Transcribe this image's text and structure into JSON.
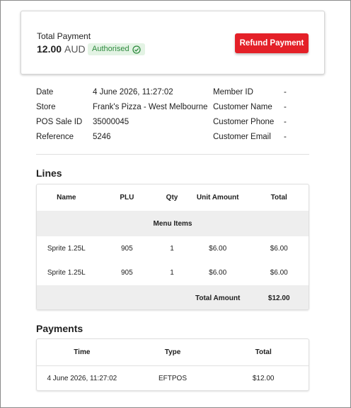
{
  "summary": {
    "total_label": "Total Payment",
    "amount": "12.00",
    "currency": "AUD",
    "status": "Authorised",
    "refund_button": "Refund Payment",
    "status_icon": "check-circle-icon",
    "accent_color": "#e42028",
    "status_color": "#2e8b3e"
  },
  "details_left": [
    {
      "label": "Date",
      "value": "4 June 2026, 11:27:02"
    },
    {
      "label": "Store",
      "value": "Frank's Pizza - West Melbourne"
    },
    {
      "label": "POS Sale ID",
      "value": "35000045"
    },
    {
      "label": "Reference",
      "value": "5246"
    }
  ],
  "details_right": [
    {
      "label": "Member ID",
      "value": "-"
    },
    {
      "label": "Customer Name",
      "value": "-"
    },
    {
      "label": "Customer Phone",
      "value": "-"
    },
    {
      "label": "Customer Email",
      "value": "-"
    }
  ],
  "lines": {
    "title": "Lines",
    "columns": [
      "Name",
      "PLU",
      "Qty",
      "Unit Amount",
      "Total"
    ],
    "group": "Menu Items",
    "rows": [
      {
        "name": "Sprite 1.25L",
        "plu": "905",
        "qty": "1",
        "unit": "$6.00",
        "total": "$6.00"
      },
      {
        "name": "Sprite 1.25L",
        "plu": "905",
        "qty": "1",
        "unit": "$6.00",
        "total": "$6.00"
      }
    ],
    "total_label": "Total Amount",
    "total_value": "$12.00"
  },
  "payments": {
    "title": "Payments",
    "columns": [
      "Time",
      "Type",
      "Total"
    ],
    "rows": [
      {
        "time": "4 June 2026, 11:27:02",
        "type": "EFTPOS",
        "total": "$12.00"
      }
    ]
  }
}
